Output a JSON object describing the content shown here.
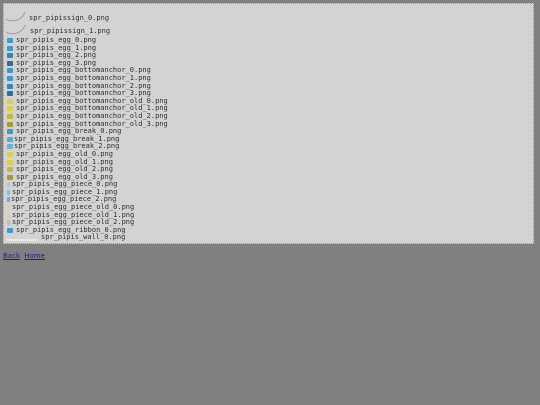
{
  "files": [
    {
      "name": "spr_pipissign_0.png",
      "icon": "sign-thumb-icon",
      "color": "#b8b8b8"
    },
    {
      "name": "spr_pipissign_1.png",
      "icon": "sign-thumb-icon",
      "color": "#b8b8b8"
    },
    {
      "name": "spr_pipis_egg_0.png",
      "icon": "egg-blue-icon",
      "color": "#3a9ad0"
    },
    {
      "name": "spr_pipis_egg_1.png",
      "icon": "egg-blue-icon",
      "color": "#3a9ad0"
    },
    {
      "name": "spr_pipis_egg_2.png",
      "icon": "egg-blue-icon",
      "color": "#2f88c0"
    },
    {
      "name": "spr_pipis_egg_3.png",
      "icon": "egg-blue-icon",
      "color": "#2a6fa0"
    },
    {
      "name": "spr_pipis_egg_bottomanchor_0.png",
      "icon": "egg-blue-icon",
      "color": "#3a9ad0"
    },
    {
      "name": "spr_pipis_egg_bottomanchor_1.png",
      "icon": "egg-blue-icon",
      "color": "#3a9ad0"
    },
    {
      "name": "spr_pipis_egg_bottomanchor_2.png",
      "icon": "egg-blue-icon",
      "color": "#2f88c0"
    },
    {
      "name": "spr_pipis_egg_bottomanchor_3.png",
      "icon": "egg-blue-icon",
      "color": "#2a6fa0"
    },
    {
      "name": "spr_pipis_egg_bottomanchor_old_0.png",
      "icon": "egg-yellow-icon",
      "color": "#e0d040"
    },
    {
      "name": "spr_pipis_egg_bottomanchor_old_1.png",
      "icon": "egg-yellow-icon",
      "color": "#e0d040"
    },
    {
      "name": "spr_pipis_egg_bottomanchor_old_2.png",
      "icon": "egg-yellow-icon",
      "color": "#c8b838"
    },
    {
      "name": "spr_pipis_egg_bottomanchor_old_3.png",
      "icon": "egg-yellow-icon",
      "color": "#a89a30"
    },
    {
      "name": "spr_pipis_egg_break_0.png",
      "icon": "egg-blue-icon",
      "color": "#3a9ad0"
    },
    {
      "name": "spr_pipis_egg_break_1.png",
      "icon": "egg-break-icon",
      "color": "#5aa8d8"
    },
    {
      "name": "spr_pipis_egg_break_2.png",
      "icon": "egg-break-icon",
      "color": "#6ab0d8"
    },
    {
      "name": "spr_pipis_egg_old_0.png",
      "icon": "egg-yellow-icon",
      "color": "#e0d040"
    },
    {
      "name": "spr_pipis_egg_old_1.png",
      "icon": "egg-yellow-icon",
      "color": "#e0d040"
    },
    {
      "name": "spr_pipis_egg_old_2.png",
      "icon": "egg-yellow-icon",
      "color": "#c8b838"
    },
    {
      "name": "spr_pipis_egg_old_3.png",
      "icon": "egg-yellow-icon",
      "color": "#a89a30"
    },
    {
      "name": "spr_pipis_egg_piece_0.png",
      "icon": "egg-piece-icon",
      "color": "#b0c8d8"
    },
    {
      "name": "spr_pipis_egg_piece_1.png",
      "icon": "egg-piece-icon",
      "color": "#8ab8d8"
    },
    {
      "name": "spr_pipis_egg_piece_2.png",
      "icon": "egg-piece-icon",
      "color": "#7aa8c8"
    },
    {
      "name": "spr_pipis_egg_piece_old_0.png",
      "icon": "egg-piece-icon",
      "color": "#d8d0a0"
    },
    {
      "name": "spr_pipis_egg_piece_old_1.png",
      "icon": "egg-piece-icon",
      "color": "#d8d0a0"
    },
    {
      "name": "spr_pipis_egg_piece_old_2.png",
      "icon": "egg-piece-icon",
      "color": "#c8c090"
    },
    {
      "name": "spr_pipis_egg_ribbon_0.png",
      "icon": "egg-blue-icon",
      "color": "#3a9ad0"
    },
    {
      "name": "spr_pipis_wall_0.png",
      "icon": "wall-thumb-icon",
      "color": "#e8e8e8"
    }
  ],
  "footer": {
    "back_label": "Back",
    "home_label": "Home"
  }
}
